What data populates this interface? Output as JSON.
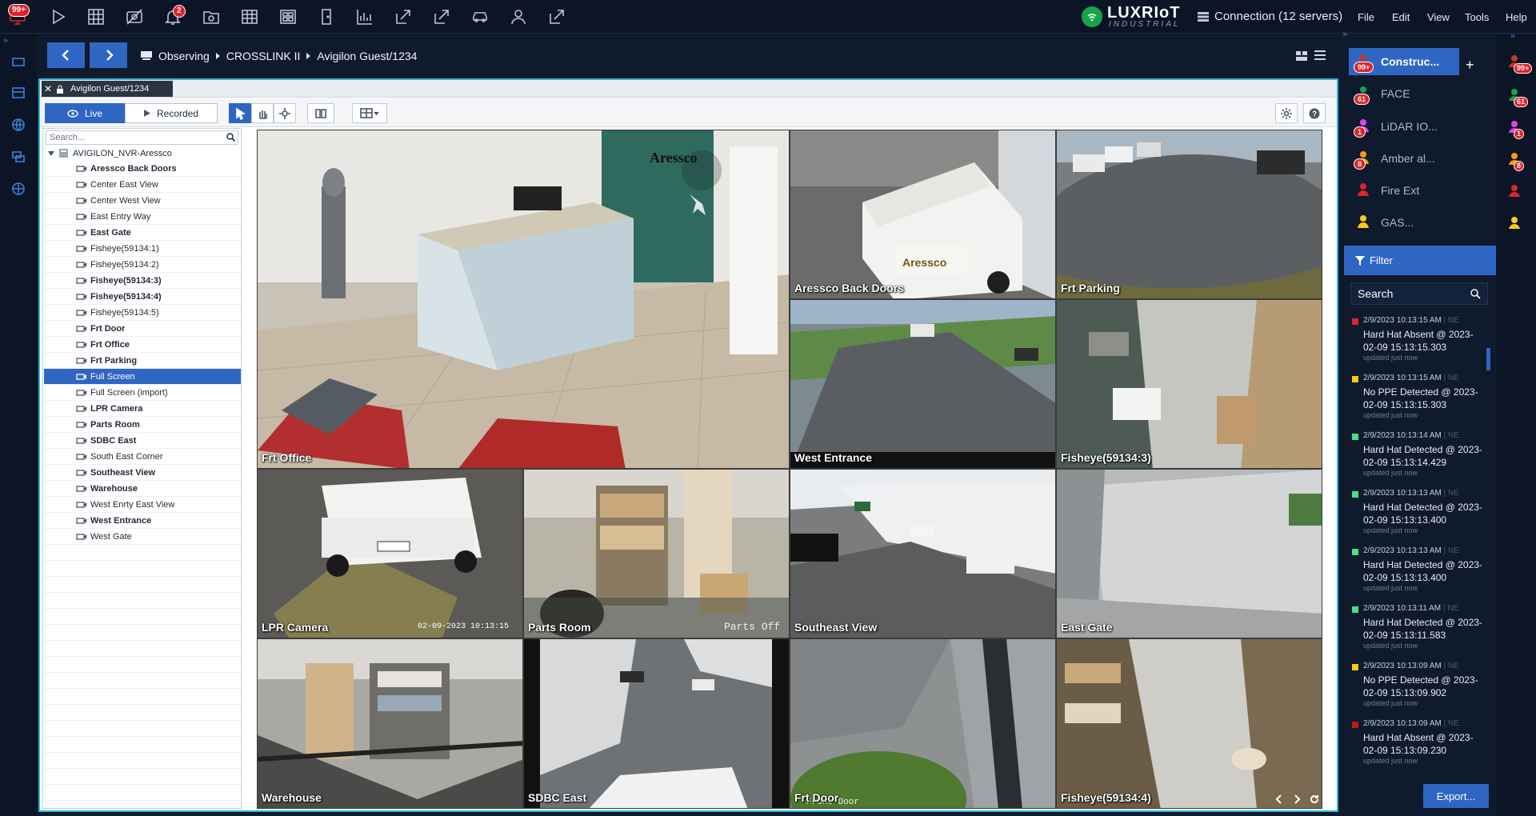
{
  "topbar": {
    "notif_badge": "99+",
    "alarm_badge": "2",
    "brand_name": "LUXRIoT",
    "brand_sub": "INDUSTRIAL",
    "connection": "Connection (12 servers)",
    "menu": [
      "File",
      "Edit",
      "View",
      "Tools",
      "Help"
    ]
  },
  "breadcrumb": [
    "Observing",
    "CROSSLINK II",
    "Avigilon Guest/1234"
  ],
  "tab": {
    "label": "Avigilon Guest/1234"
  },
  "toolbar": {
    "live_label": "Live",
    "recorded_label": "Recorded"
  },
  "tree": {
    "search_placeholder": "Search...",
    "root": "AVIGILON_NVR-Aressco",
    "items": [
      {
        "label": "Aressco Back Doors",
        "bold": true
      },
      {
        "label": "Center East View",
        "bold": false
      },
      {
        "label": "Center West View",
        "bold": false
      },
      {
        "label": "East Entry Way",
        "bold": false
      },
      {
        "label": "East Gate",
        "bold": true
      },
      {
        "label": "Fisheye(59134:1)",
        "bold": false
      },
      {
        "label": "Fisheye(59134:2)",
        "bold": false
      },
      {
        "label": "Fisheye(59134:3)",
        "bold": true
      },
      {
        "label": "Fisheye(59134:4)",
        "bold": true
      },
      {
        "label": "Fisheye(59134:5)",
        "bold": false
      },
      {
        "label": "Frt Door",
        "bold": true
      },
      {
        "label": "Frt Office",
        "bold": true
      },
      {
        "label": "Frt Parking",
        "bold": true
      },
      {
        "label": "Full Screen",
        "bold": false,
        "selected": true
      },
      {
        "label": "Full Screen (import)",
        "bold": false
      },
      {
        "label": "LPR Camera",
        "bold": true
      },
      {
        "label": "Parts Room",
        "bold": true
      },
      {
        "label": "SDBC East",
        "bold": true
      },
      {
        "label": "South East Corner",
        "bold": false
      },
      {
        "label": "Southeast View",
        "bold": true
      },
      {
        "label": "Warehouse",
        "bold": true
      },
      {
        "label": "West Enrty East View",
        "bold": false
      },
      {
        "label": "West Entrance",
        "bold": true
      },
      {
        "label": "West Gate",
        "bold": false
      }
    ]
  },
  "cameras": {
    "c1": "Frt Office",
    "c2": "Aressco Back Doors",
    "c3": "Frt Parking",
    "c4": "West Entrance",
    "c5": "Fisheye(59134:3)",
    "c6": "LPR Camera",
    "c7": "Parts Room",
    "c8": "Southeast View",
    "c9": "East Gate",
    "c10": "Warehouse",
    "c11": "SDBC East",
    "c12": "Frt Door",
    "c13": "Fisheye(59134:4)"
  },
  "overlays": {
    "lpr_timestamp": "02-09-2023 10:13:15",
    "parts_overlay": "Parts Off",
    "door_overlay": "Front Door",
    "aressco_sign": "Aressco",
    "van_logo": "Aressco"
  },
  "groups": [
    {
      "label": "Construc...",
      "badge": "99+",
      "color": "#c0392b"
    },
    {
      "label": "FACE",
      "badge": "61",
      "color": "#16a34a"
    },
    {
      "label": "LiDAR IO...",
      "badge": "1",
      "color": "#d946ef"
    },
    {
      "label": "Amber al...",
      "badge": "8",
      "color": "#f59e0b"
    },
    {
      "label": "Fire Ext",
      "badge": "",
      "color": "#e1222a"
    },
    {
      "label": "GAS...",
      "badge": "",
      "color": "#facc15"
    }
  ],
  "filter_label": "Filter",
  "events_search_placeholder": "Search",
  "events": [
    {
      "time": "2/9/2023 10:13:15 AM",
      "src": "NE",
      "title": "Hard Hat Absent @ 2023-02-09 15:13:15.303",
      "updated": "updated just now",
      "color": "#e1222a"
    },
    {
      "time": "2/9/2023 10:13:15 AM",
      "src": "NE",
      "title": "No PPE Detected @ 2023-02-09 15:13:15.303",
      "updated": "updated just now",
      "color": "#facc15"
    },
    {
      "time": "2/9/2023 10:13:14 AM",
      "src": "NE",
      "title": "Hard Hat Detected @ 2023-02-09 15:13:14.429",
      "updated": "updated just now",
      "color": "#4ade80"
    },
    {
      "time": "2/9/2023 10:13:13 AM",
      "src": "NE",
      "title": "Hard Hat Detected @ 2023-02-09 15:13:13.400",
      "updated": "updated just now",
      "color": "#4ade80"
    },
    {
      "time": "2/9/2023 10:13:13 AM",
      "src": "NE",
      "title": "Hard Hat Detected @ 2023-02-09 15:13:13.400",
      "updated": "updated just now",
      "color": "#4ade80"
    },
    {
      "time": "2/9/2023 10:13:11 AM",
      "src": "NE",
      "title": "Hard Hat Detected @ 2023-02-09 15:13:11.583",
      "updated": "updated just now",
      "color": "#4ade80"
    },
    {
      "time": "2/9/2023 10:13:09 AM",
      "src": "NE",
      "title": "No PPE Detected @ 2023-02-09 15:13:09.902",
      "updated": "updated just now",
      "color": "#facc15"
    },
    {
      "time": "2/9/2023 10:13:09 AM",
      "src": "NE",
      "title": "Hard Hat Absent @ 2023-02-09 15:13:09.230",
      "updated": "updated just now",
      "color": "#b91c1c"
    }
  ],
  "export_label": "Export...",
  "rail_badges": [
    "99+",
    "61",
    "1",
    "8"
  ]
}
